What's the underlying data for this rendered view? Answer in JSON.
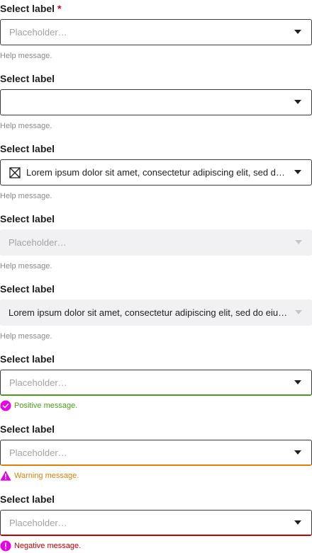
{
  "colors": {
    "label": "#1f1f1f",
    "required": "#d1001c",
    "help": "#8a8a8a",
    "placeholder": "#a3a3a3",
    "border": "#3b3b3b",
    "disabled_bg": "#f1f1f3",
    "positive": "#4a9e17",
    "warning": "#dd8106",
    "negative": "#c40000",
    "status_icon": "#e800e8"
  },
  "fields": [
    {
      "label": "Select label",
      "required_mark": "*",
      "placeholder": "Placeholder…",
      "help": "Help message.",
      "icon": "chevron-down-icon"
    },
    {
      "label": "Select label",
      "value": "",
      "help": "Help message.",
      "icon": "chevron-down-icon"
    },
    {
      "label": "Select label",
      "value": "Lorem ipsum dolor sit amet, consectetur adipiscing elit, sed do eiusmod tempor",
      "leading_icon": "image-placeholder-icon",
      "help": "Help message.",
      "icon": "chevron-down-icon"
    },
    {
      "label": "Select label",
      "placeholder": "Placeholder…",
      "help": "Help message.",
      "state": "disabled",
      "icon": "chevron-down-icon"
    },
    {
      "label": "Select label",
      "value": "Lorem ipsum dolor sit amet, consectetur adipiscing elit, sed do eiusmod tempor",
      "help": "Help message.",
      "state": "disabled",
      "icon": "chevron-down-icon"
    },
    {
      "label": "Select label",
      "placeholder": "Placeholder…",
      "message": "Positive message.",
      "state": "positive",
      "message_icon": "check-circle-icon"
    },
    {
      "label": "Select label",
      "placeholder": "Placeholder…",
      "message": "Warning message.",
      "state": "warning",
      "message_icon": "warning-triangle-icon"
    },
    {
      "label": "Select label",
      "placeholder": "Placeholder…",
      "message": "Negative message.",
      "state": "negative",
      "message_icon": "exclamation-circle-icon"
    }
  ]
}
